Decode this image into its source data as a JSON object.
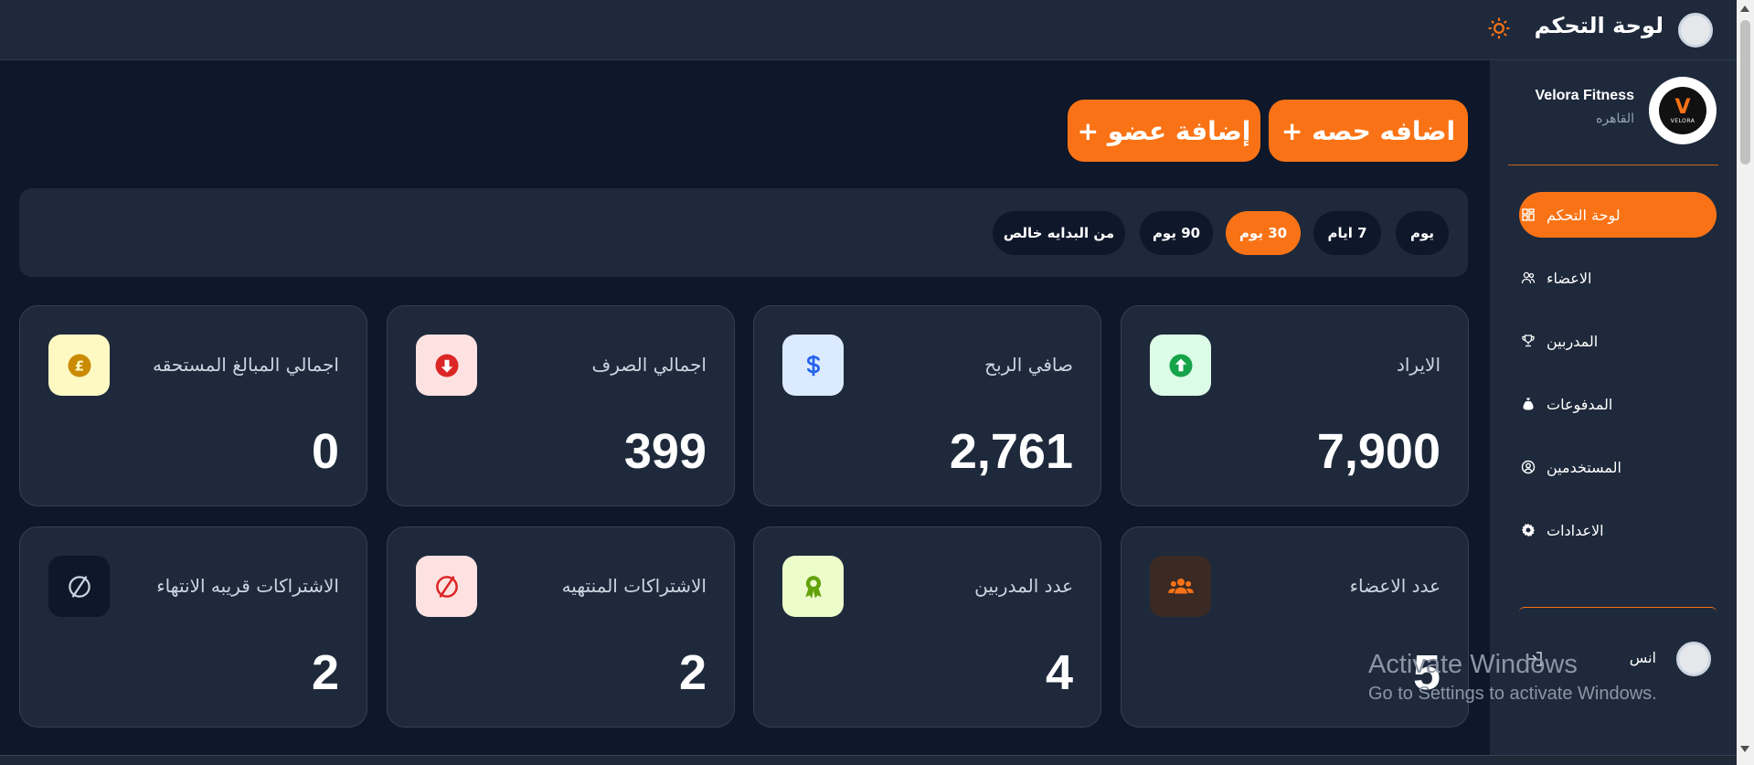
{
  "topbar": {
    "title": "لوحة التحكم",
    "theme_icon": "sun-icon"
  },
  "sidebar": {
    "brand_name": "Velora Fitness",
    "brand_city": "القاهره",
    "logo_text": "VELORA",
    "items": [
      {
        "label": "لوحة التحكم",
        "icon": "dashboard-icon",
        "active": true
      },
      {
        "label": "الاعضاء",
        "icon": "users-icon",
        "active": false
      },
      {
        "label": "المدربين",
        "icon": "trophy-icon",
        "active": false
      },
      {
        "label": "المدفوعات",
        "icon": "money-bag-icon",
        "active": false
      },
      {
        "label": "المستخدمين",
        "icon": "user-circle-icon",
        "active": false
      },
      {
        "label": "الاعدادات",
        "icon": "gear-icon",
        "active": false
      }
    ],
    "user_name": "انس"
  },
  "actions": {
    "add_session": "اضافه حصه +",
    "add_member": "إضافة عضو +"
  },
  "filters": [
    {
      "label": "يوم",
      "active": false
    },
    {
      "label": "7 ايام",
      "active": false
    },
    {
      "label": "30 يوم",
      "active": true
    },
    {
      "label": "90 يوم",
      "active": false
    },
    {
      "label": "من البدايه خالص",
      "active": false
    }
  ],
  "stats": [
    {
      "label": "الايراد",
      "value": "7,900",
      "icon": "arrow-up-circle-icon",
      "icon_bg": "#dcfce7",
      "icon_color": "#16a34a"
    },
    {
      "label": "صافي الربح",
      "value": "2,761",
      "icon": "dollar-icon",
      "icon_bg": "#dbeafe",
      "icon_color": "#2563eb"
    },
    {
      "label": "اجمالي الصرف",
      "value": "399",
      "icon": "arrow-down-circle-icon",
      "icon_bg": "#fee2e2",
      "icon_color": "#dc2626"
    },
    {
      "label": "اجمالي المبالغ المستحقه",
      "value": "0",
      "icon": "pound-coin-icon",
      "icon_bg": "#fef9c3",
      "icon_color": "#ca8a04"
    },
    {
      "label": "عدد الاعضاء",
      "value": "5",
      "icon": "group-icon",
      "icon_bg": "#3b2a24",
      "icon_color": "#f97316"
    },
    {
      "label": "عدد المدربين",
      "value": "4",
      "icon": "award-icon",
      "icon_bg": "#ecfccb",
      "icon_color": "#65a30d"
    },
    {
      "label": "الاشتراكات المنتهيه",
      "value": "2",
      "icon": "ban-icon",
      "icon_bg": "#fee2e2",
      "icon_color": "#dc2626"
    },
    {
      "label": "الاشتراكات قريبه الانتهاء",
      "value": "2",
      "icon": "ban-icon",
      "icon_bg": "#0f172a",
      "icon_color": "#cbd5e1"
    }
  ],
  "watermark": {
    "line1": "Activate Windows",
    "line2": "Go to Settings to activate Windows."
  },
  "colors": {
    "accent": "#f97316",
    "background": "#0f172a",
    "panel": "#1e293b"
  }
}
